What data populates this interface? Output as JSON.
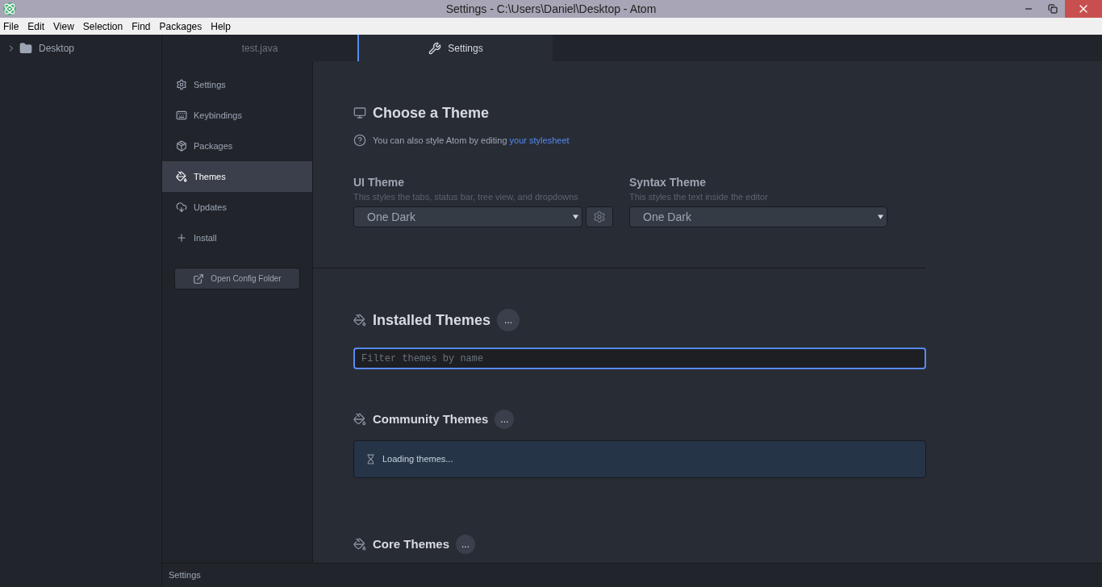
{
  "window": {
    "title": "Settings - C:\\Users\\Daniel\\Desktop - Atom"
  },
  "menu": [
    "File",
    "Edit",
    "View",
    "Selection",
    "Find",
    "Packages",
    "Help"
  ],
  "tree": {
    "label": "Desktop",
    "expanded": false
  },
  "tabs": [
    {
      "label": "test.java",
      "selected": false,
      "kind": "file"
    },
    {
      "label": "Settings",
      "selected": true,
      "kind": "settings"
    }
  ],
  "nav": {
    "items": [
      {
        "label": "Settings",
        "selected": false,
        "kind": "settings"
      },
      {
        "label": "Keybindings",
        "selected": false,
        "kind": "keyboard"
      },
      {
        "label": "Packages",
        "selected": false,
        "kind": "package"
      },
      {
        "label": "Themes",
        "selected": true,
        "kind": "themes"
      },
      {
        "label": "Updates",
        "selected": false,
        "kind": "updates"
      },
      {
        "label": "Install",
        "selected": false,
        "kind": "install"
      }
    ],
    "button": "Open Config Folder"
  },
  "choose": {
    "title": "Choose a Theme",
    "note": "You can also style Atom by editing",
    "link": "your stylesheet",
    "ui": {
      "label": "UI Theme",
      "hint": "This styles the tabs, status bar, tree view, and dropdowns",
      "value": "One Dark"
    },
    "syntax": {
      "label": "Syntax Theme",
      "hint": "This styles the text inside the editor",
      "value": "One Dark"
    }
  },
  "installed": {
    "title": "Installed Themes",
    "badge": "...",
    "placeholder": "Filter themes by name"
  },
  "community": {
    "title": "Community Themes",
    "badge": "...",
    "loading": "Loading themes..."
  },
  "core": {
    "title": "Core Themes",
    "badge": "..."
  },
  "status_bar": "Settings"
}
